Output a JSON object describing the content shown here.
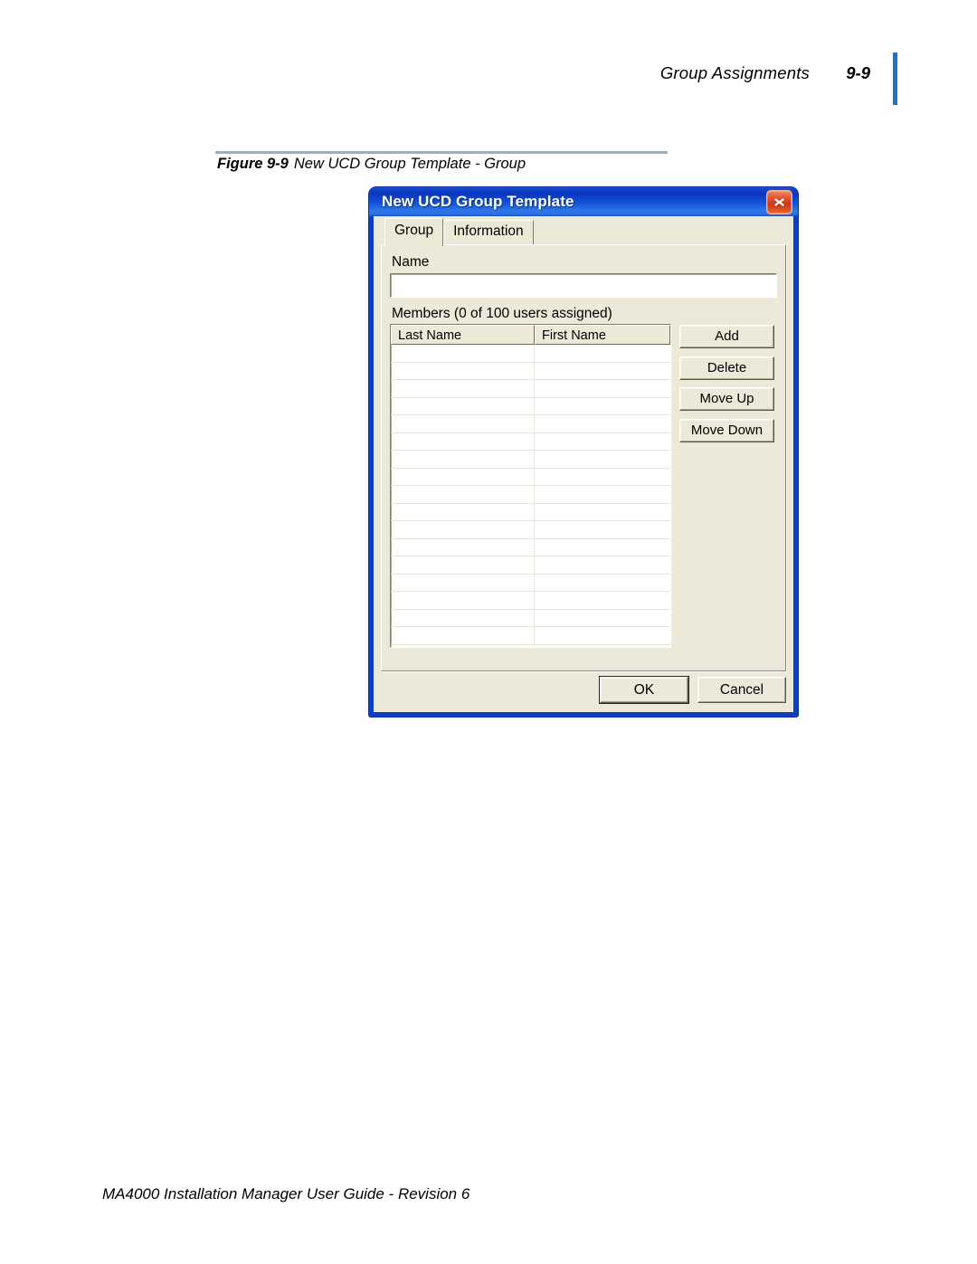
{
  "page": {
    "header": {
      "title": "Group Assignments",
      "page_number": "9-9",
      "accent_color": "#1f73c4"
    },
    "figure": {
      "label": "Figure 9-9",
      "caption": "New UCD Group Template - Group",
      "rule_color": "#8ab4d4"
    },
    "footer": {
      "text": "MA4000 Installation Manager User Guide - Revision 6"
    }
  },
  "dialog": {
    "title": "New UCD Group Template",
    "title_bar_color": "#1042c8",
    "close_icon": "close-icon",
    "close_color": "#cf3412",
    "tabs": [
      {
        "label": "Group",
        "active": true
      },
      {
        "label": "Information",
        "active": false
      }
    ],
    "name_field": {
      "label": "Name",
      "value": "",
      "placeholder": ""
    },
    "members": {
      "label": "Members (0 of 100 users assigned)",
      "assigned_count": 0,
      "max_users": 100,
      "columns": [
        "Last Name",
        "First Name"
      ],
      "rows": [],
      "visible_empty_rows": 18
    },
    "side_buttons": [
      {
        "label": "Add"
      },
      {
        "label": "Delete"
      },
      {
        "label": "Move Up"
      },
      {
        "label": "Move Down"
      }
    ],
    "footer_buttons": [
      {
        "label": "OK",
        "default": true
      },
      {
        "label": "Cancel",
        "default": false
      }
    ]
  }
}
